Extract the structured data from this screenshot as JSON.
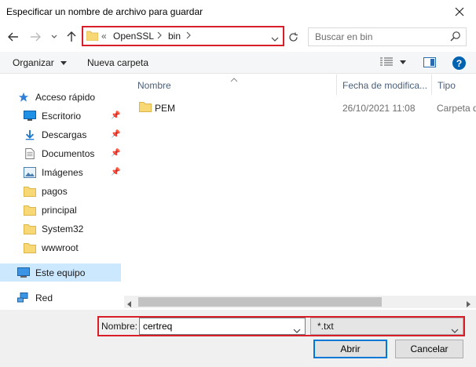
{
  "window": {
    "title": "Especificar un nombre de archivo para guardar"
  },
  "address_bar": {
    "prefix": "«",
    "crumbs": [
      "OpenSSL",
      "bin"
    ]
  },
  "search": {
    "placeholder": "Buscar en bin"
  },
  "toolbar": {
    "organize_label": "Organizar",
    "new_folder_label": "Nueva carpeta"
  },
  "sidebar": {
    "items": [
      {
        "label": "Acceso rápido",
        "icon": "star-icon"
      },
      {
        "label": "Escritorio",
        "icon": "desktop-icon",
        "pinned": true
      },
      {
        "label": "Descargas",
        "icon": "download-icon",
        "pinned": true
      },
      {
        "label": "Documentos",
        "icon": "document-icon",
        "pinned": true
      },
      {
        "label": "Imágenes",
        "icon": "image-icon",
        "pinned": true
      },
      {
        "label": "pagos",
        "icon": "folder-icon"
      },
      {
        "label": "principal",
        "icon": "folder-icon"
      },
      {
        "label": "System32",
        "icon": "folder-icon"
      },
      {
        "label": "wwwroot",
        "icon": "folder-icon"
      },
      {
        "label": "Este equipo",
        "icon": "computer-icon"
      },
      {
        "label": "Red",
        "icon": "network-icon"
      }
    ]
  },
  "columns": {
    "name": "Nombre",
    "date": "Fecha de modifica...",
    "type": "Tipo"
  },
  "files": [
    {
      "name": "PEM",
      "date": "26/10/2021 11:08",
      "type": "Carpeta d"
    }
  ],
  "footer": {
    "name_label": "Nombre:",
    "name_value": "certreq",
    "type_value": "*.txt",
    "open_label": "Abrir",
    "cancel_label": "Cancelar"
  },
  "colors": {
    "accent": "#0078d7",
    "highlight_border": "#d81e28",
    "folder": "#f8d775"
  }
}
